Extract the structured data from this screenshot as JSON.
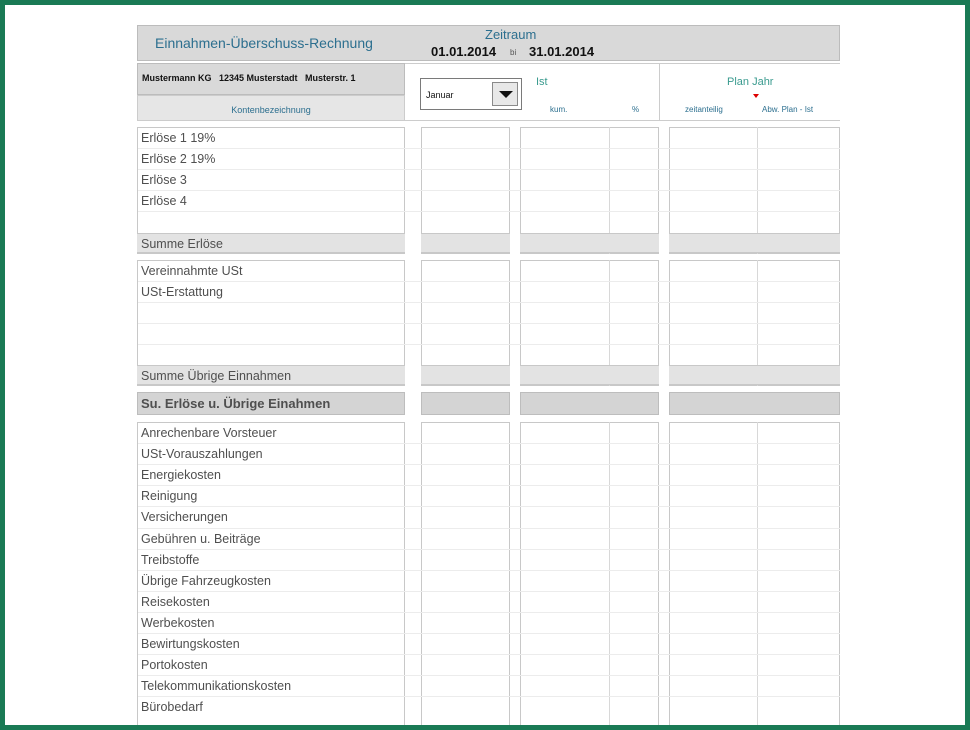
{
  "header": {
    "title": "Einnahmen-Überschuss-Rechnung",
    "zeitraum_label": "Zeitraum",
    "date_from": "01.01.2014",
    "bis": "bi",
    "date_to": "31.01.2014"
  },
  "company": {
    "address": "Mustermann KG   12345 Musterstadt   Musterstr. 1"
  },
  "columns": {
    "kontenbezeichnung": "Kontenbezeichnung",
    "ist": "Ist",
    "kum": "kum.",
    "percent": "%",
    "plan_jahr": "Plan Jahr",
    "zeitanteilig": "zeitanteilig",
    "abw": "Abw. Plan - Ist"
  },
  "month_select": {
    "value": "Januar"
  },
  "sections": {
    "erloese": [
      "Erlöse 1 19%",
      "Erlöse 2 19%",
      "Erlöse 3",
      "Erlöse 4",
      ""
    ],
    "summe_erloese": "Summe Erlöse",
    "uebrige": [
      "Vereinnahmte USt",
      "USt-Erstattung",
      "",
      "",
      ""
    ],
    "summe_uebrige": "Summe Übrige Einnahmen",
    "su_total": "Su. Erlöse u. Übrige Einahmen",
    "ausgaben": [
      "Anrechenbare Vorsteuer",
      "USt-Vorauszahlungen",
      "Energiekosten",
      "Reinigung",
      "Versicherungen",
      "Gebühren u. Beiträge",
      "Treibstoffe",
      "Übrige Fahrzeugkosten",
      "Reisekosten",
      "Werbekosten",
      "Bewirtungskosten",
      "Portokosten",
      "Telekommunikationskosten",
      "Bürobedarf"
    ]
  }
}
